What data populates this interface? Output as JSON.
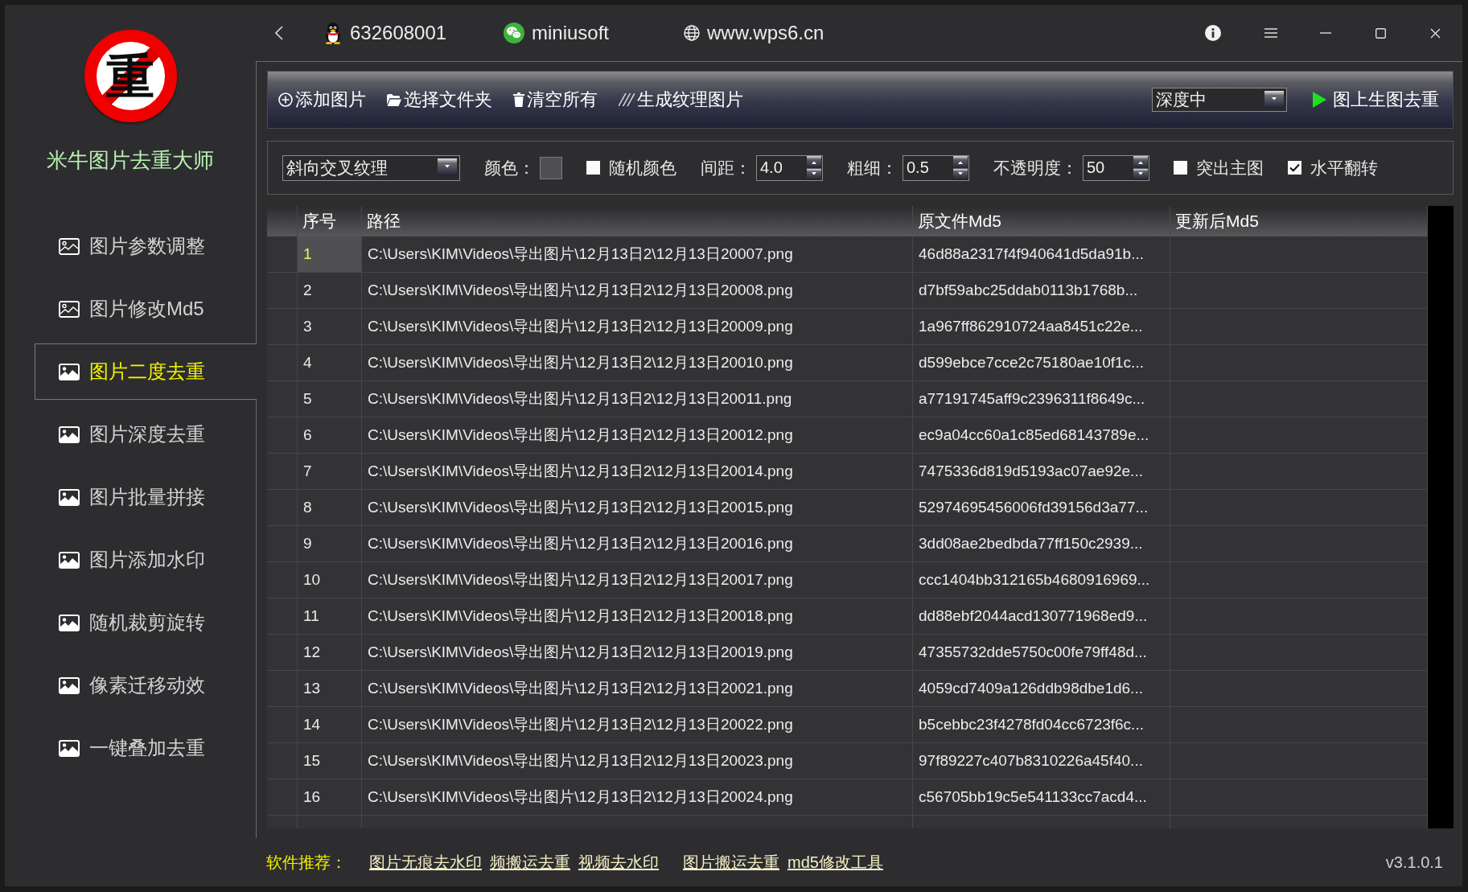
{
  "sidebar": {
    "logo": {
      "glyph": "重"
    },
    "app_name": "米牛图片去重大师",
    "items": [
      {
        "label": "图片参数调整",
        "kind": "outline",
        "selected": false
      },
      {
        "label": "图片修改Md5",
        "kind": "outline",
        "selected": false
      },
      {
        "label": "图片二度去重",
        "kind": "filled",
        "selected": true
      },
      {
        "label": "图片深度去重",
        "kind": "filled",
        "selected": false
      },
      {
        "label": "图片批量拼接",
        "kind": "filled",
        "selected": false
      },
      {
        "label": "图片添加水印",
        "kind": "filled",
        "selected": false
      },
      {
        "label": "随机裁剪旋转",
        "kind": "filled",
        "selected": false
      },
      {
        "label": "像素迁移动效",
        "kind": "filled",
        "selected": false
      },
      {
        "label": "一键叠加去重",
        "kind": "filled",
        "selected": false
      }
    ]
  },
  "title_bar": {
    "contacts": [
      {
        "kind": "qq",
        "text": "632608001"
      },
      {
        "kind": "wechat",
        "text": "miniusoft"
      },
      {
        "kind": "web",
        "text": "www.wps6.cn"
      }
    ]
  },
  "toolbar": {
    "buttons": [
      {
        "kind": "add",
        "label": "添加图片"
      },
      {
        "kind": "folder",
        "label": "选择文件夹"
      },
      {
        "kind": "clear",
        "label": "清空所有"
      },
      {
        "kind": "texture",
        "label": "生成纹理图片"
      }
    ],
    "mode": {
      "value": "深度中"
    },
    "run_button": {
      "label": "图上生图去重"
    }
  },
  "options": {
    "items": [
      {
        "kind": "dropdown",
        "value": "斜向交叉纹理"
      },
      {
        "kind": "color",
        "label": "颜色：",
        "color": "#505054"
      },
      {
        "kind": "checkbox",
        "label": "随机颜色",
        "checked": false
      },
      {
        "kind": "spinbox",
        "label": "间距：",
        "value": "4.0"
      },
      {
        "kind": "spinbox",
        "label": "粗细：",
        "value": "0.5"
      },
      {
        "kind": "spinbox",
        "label": "不透明度：",
        "value": "50"
      },
      {
        "kind": "checkbox",
        "label": "突出主图",
        "checked": false
      },
      {
        "kind": "checkbox",
        "label": "水平翻转",
        "checked": true
      }
    ]
  },
  "table": {
    "columns": [
      "序号",
      "路径",
      "原文件Md5",
      "更新后Md5"
    ],
    "rows": [
      {
        "index": "1",
        "path": "C:\\Users\\KIM\\Videos\\导出图片\\12月13日2\\12月13日20007.png",
        "md5": "46d88a2317f4f940641d5da91b...",
        "selected": true
      },
      {
        "index": "2",
        "path": "C:\\Users\\KIM\\Videos\\导出图片\\12月13日2\\12月13日20008.png",
        "md5": "d7bf59abc25ddab0113b1768b...",
        "selected": false
      },
      {
        "index": "3",
        "path": "C:\\Users\\KIM\\Videos\\导出图片\\12月13日2\\12月13日20009.png",
        "md5": "1a967ff862910724aa8451c22e...",
        "selected": false
      },
      {
        "index": "4",
        "path": "C:\\Users\\KIM\\Videos\\导出图片\\12月13日2\\12月13日20010.png",
        "md5": "d599ebce7cce2c75180ae10f1c...",
        "selected": false
      },
      {
        "index": "5",
        "path": "C:\\Users\\KIM\\Videos\\导出图片\\12月13日2\\12月13日20011.png",
        "md5": "a77191745aff9c2396311f8649c...",
        "selected": false
      },
      {
        "index": "6",
        "path": "C:\\Users\\KIM\\Videos\\导出图片\\12月13日2\\12月13日20012.png",
        "md5": "ec9a04cc60a1c85ed68143789e...",
        "selected": false
      },
      {
        "index": "7",
        "path": "C:\\Users\\KIM\\Videos\\导出图片\\12月13日2\\12月13日20014.png",
        "md5": "7475336d819d5193ac07ae92e...",
        "selected": false
      },
      {
        "index": "8",
        "path": "C:\\Users\\KIM\\Videos\\导出图片\\12月13日2\\12月13日20015.png",
        "md5": "52974695456006fd39156d3a77...",
        "selected": false
      },
      {
        "index": "9",
        "path": "C:\\Users\\KIM\\Videos\\导出图片\\12月13日2\\12月13日20016.png",
        "md5": "3dd08ae2bedbda77ff150c2939...",
        "selected": false
      },
      {
        "index": "10",
        "path": "C:\\Users\\KIM\\Videos\\导出图片\\12月13日2\\12月13日20017.png",
        "md5": "ccc1404bb312165b4680916969...",
        "selected": false
      },
      {
        "index": "11",
        "path": "C:\\Users\\KIM\\Videos\\导出图片\\12月13日2\\12月13日20018.png",
        "md5": "dd88ebf2044acd130771968ed9...",
        "selected": false
      },
      {
        "index": "12",
        "path": "C:\\Users\\KIM\\Videos\\导出图片\\12月13日2\\12月13日20019.png",
        "md5": "47355732dde5750c00fe79ff48d...",
        "selected": false
      },
      {
        "index": "13",
        "path": "C:\\Users\\KIM\\Videos\\导出图片\\12月13日2\\12月13日20021.png",
        "md5": "4059cd7409a126ddb98dbe1d6...",
        "selected": false
      },
      {
        "index": "14",
        "path": "C:\\Users\\KIM\\Videos\\导出图片\\12月13日2\\12月13日20022.png",
        "md5": "b5cebbc23f4278fd04cc6723f6c...",
        "selected": false
      },
      {
        "index": "15",
        "path": "C:\\Users\\KIM\\Videos\\导出图片\\12月13日2\\12月13日20023.png",
        "md5": "97f89227c407b8310226a45f40...",
        "selected": false
      },
      {
        "index": "16",
        "path": "C:\\Users\\KIM\\Videos\\导出图片\\12月13日2\\12月13日20024.png",
        "md5": "c56705bb19c5e541133cc7acd4...",
        "selected": false
      }
    ]
  },
  "footer": {
    "label": "软件推荐：",
    "links": [
      "图片无痕去水印",
      "频搬运去重",
      "视频去水印",
      "图片搬运去重",
      "md5修改工具"
    ],
    "version": "v3.1.0.1"
  }
}
